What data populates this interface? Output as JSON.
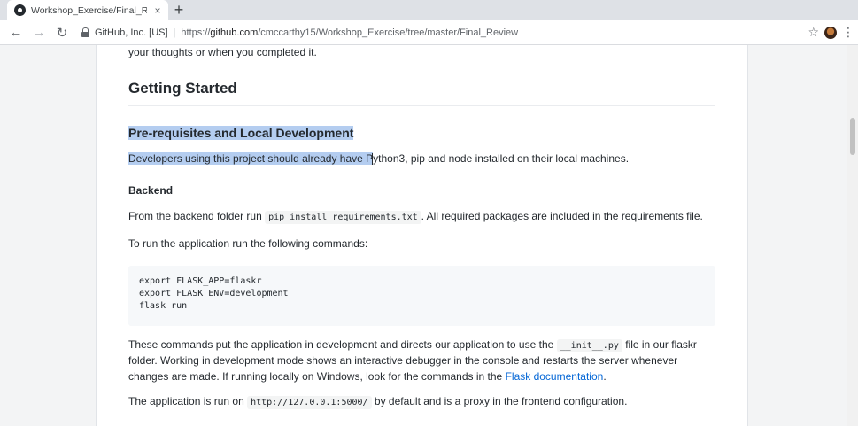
{
  "browser": {
    "tab_title": "Workshop_Exercise/Final_Review",
    "tab_close": "×",
    "new_tab": "+",
    "site_identity": "GitHub, Inc. [US]",
    "separator": "|",
    "url_prefix": "https://",
    "url_host": "github.com",
    "url_path": "/cmccarthy15/Workshop_Exercise/tree/master/Final_Review",
    "back": "←",
    "forward": "→",
    "reload": "↻",
    "star": "☆",
    "menu": "⋮"
  },
  "readme": {
    "intro_tail": "your thoughts or when you completed it.",
    "heading_getting_started": "Getting Started",
    "heading_prereq": "Pre-requisites and Local Development",
    "prereq_highlighted": "Developers using this project should already have P",
    "prereq_rest": "ython3, pip and node installed on their local machines.",
    "heading_backend": "Backend",
    "backend_text_1": "From the backend folder run",
    "backend_code": "pip install requirements.txt",
    "backend_text_2": ". All required packages are included in the requirements file.",
    "run_text": "To run the application run the following commands:",
    "code_line_1": "export FLASK_APP=flaskr",
    "code_line_2": "export FLASK_ENV=development",
    "code_line_3": "flask run",
    "commands_text_1": "These commands put the application in development and directs our application to use the",
    "commands_code": "__init__.py",
    "commands_text_2": "file in our flaskr folder. Working in development mode shows an interactive debugger in the console and restarts the server whenever changes are made. If running locally on Windows, look for the commands in the",
    "flask_doc_link": "Flask documentation",
    "commands_text_3": ".",
    "app_run_text_1": "The application is run on",
    "app_run_code": "http://127.0.0.1:5000/",
    "app_run_text_2": "by default and is a proxy in the frontend configuration."
  }
}
